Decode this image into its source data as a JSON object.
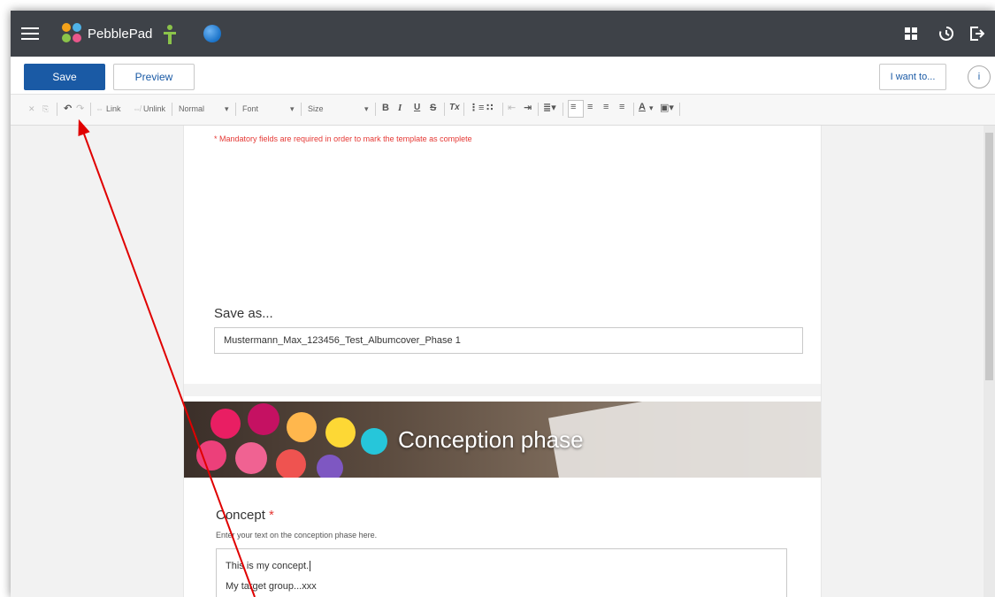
{
  "app": {
    "name": "PebblePad"
  },
  "actions": {
    "save": "Save",
    "preview": "Preview",
    "i_want_to": "I want to...",
    "info": "i"
  },
  "toolbar": {
    "link": "Link",
    "unlink": "Unlink",
    "format": "Normal",
    "font": "Font",
    "size": "Size",
    "bold": "B",
    "italic": "I",
    "underline": "U",
    "strike": "S",
    "remove_format": "Tx",
    "font_color": "A"
  },
  "form": {
    "mandatory_note": "* Mandatory fields are required in order to mark the template as complete",
    "save_as_label": "Save as...",
    "save_as_value": "Mustermann_Max_123456_Test_Albumcover_Phase 1",
    "banner_title": "Conception phase",
    "concept_label": "Concept",
    "concept_required": "*",
    "concept_hint": "Enter your text on the conception phase here.",
    "concept_line1": "This is my concept.",
    "concept_line2": "My target group...xxx"
  },
  "colors": {
    "topbar": "#3e4248",
    "primary": "#1a5aa5",
    "required": "#e53935",
    "annotation": "#e00000"
  },
  "icons": [
    "menu-icon",
    "pebblepad-logo-icon",
    "person-icon",
    "globe-icon",
    "apps-grid-icon",
    "history-icon",
    "logout-icon",
    "info-icon",
    "undo-icon",
    "redo-icon",
    "cut-icon",
    "copy-icon"
  ]
}
